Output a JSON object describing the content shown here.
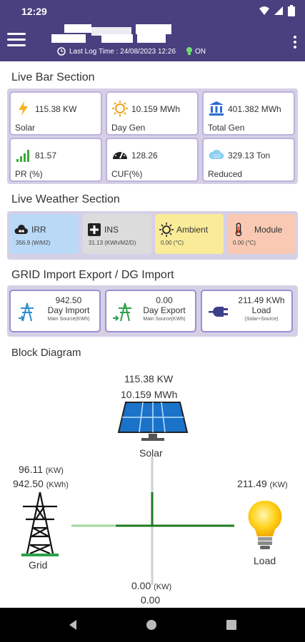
{
  "status_bar": {
    "time": "12:29"
  },
  "app_bar": {
    "last_log_label": "Last Log Time : 24/08/2023 12:26",
    "status": "ON"
  },
  "live_bar": {
    "title": "Live Bar Section",
    "cards": [
      {
        "value": "115.38 KW",
        "label": "Solar",
        "icon": "bolt-icon"
      },
      {
        "value": "10.159 MWh",
        "label": "Day Gen",
        "icon": "sun-icon"
      },
      {
        "value": "401.382 MWh",
        "label": "Total Gen",
        "icon": "bank-icon"
      },
      {
        "value": "81.57",
        "label": "PR (%)",
        "icon": "signal-bars-icon"
      },
      {
        "value": "128.26",
        "label": "CUF(%)",
        "icon": "speedometer-icon"
      },
      {
        "value": "329.13 Ton",
        "label": "Reduced",
        "icon": "co2-cloud-icon"
      }
    ]
  },
  "weather": {
    "title": "Live Weather Section",
    "cards": [
      {
        "title": "IRR",
        "value": "356.9  (W/M2)",
        "color": "#b9d9f7"
      },
      {
        "title": "INS",
        "value": "31.13 (KWh/M2/D)",
        "color": "#dcdcdc"
      },
      {
        "title": "Ambient",
        "value": "0.00 (°C)",
        "color": "#faeb99"
      },
      {
        "title": "Module",
        "value": "0.00 (°C)",
        "color": "#f9c9b3"
      }
    ]
  },
  "grid": {
    "title": "GRID Import Export / DG Import",
    "cards": [
      {
        "value": "942.50",
        "label": "Day Import",
        "sub": "Main Source(KWh)"
      },
      {
        "value": "0.00",
        "label": "Day Export",
        "sub": "Main Source(KWh)"
      },
      {
        "value": "211.49 KWh",
        "label": "Load",
        "sub": "(Solar+Source)"
      }
    ]
  },
  "block_diagram": {
    "title": "Block Diagram",
    "solar_kw": "115.38 KW",
    "solar_mwh": "10.159 MWh",
    "solar_label": "Solar",
    "grid_kw": "96.11",
    "grid_kw_unit": "(KW)",
    "grid_kwh": "942.50",
    "grid_kwh_unit": "(KWh)",
    "grid_label": "Grid",
    "load_kw": "211.49",
    "load_kw_unit": "(KW)",
    "load_label": "Load",
    "dg_kw": "0.00",
    "dg_kw_unit": "(KW)",
    "dg_kwh": "0.00"
  },
  "colors": {
    "primary": "#4a3f7f",
    "panel": "#d6d0e6",
    "flow_green": "#1f7a1f"
  }
}
